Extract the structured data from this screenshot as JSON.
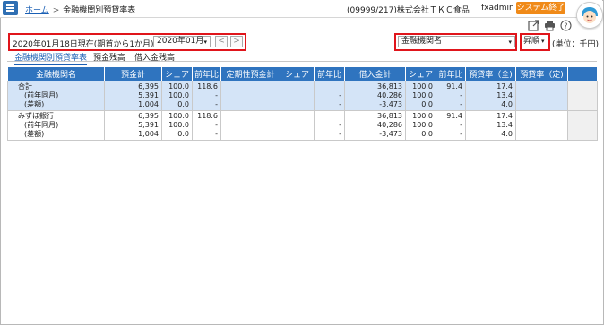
{
  "header": {
    "home_link": "ホーム",
    "breadcrumb_sep": ">",
    "page_title": "金融機関別預貸率表",
    "company": "(09999/217)株式会社ＴＫＣ食品",
    "user": "fxadmin",
    "user_caret": "▾",
    "system_exit": "システム終了"
  },
  "controls": {
    "date_label": "2020年01月18日現在(期首から1か月)",
    "month_value": "2020年01月",
    "prev_label": "<",
    "next_label": ">",
    "bank_select": "金融機関名",
    "order_select": "昇順",
    "caret": "▾",
    "unit": "(単位：千円)"
  },
  "tabs": [
    "金融機関別預貸率表",
    "預金残高",
    "借入金残高"
  ],
  "table": {
    "headers": [
      "金融機関名",
      "預金計",
      "シェア",
      "前年比",
      "定期性預金計",
      "シェア",
      "前年比",
      "借入金計",
      "シェア",
      "前年比",
      "預貸率（全)",
      "預貸率（定)"
    ],
    "rows": [
      {
        "name": [
          "合計",
          "(前年同月)",
          "(差額)"
        ],
        "deposit": [
          "6,395",
          "5,391",
          "1,004"
        ],
        "share": [
          "100.0",
          "100.0",
          "0.0"
        ],
        "yoy": [
          "118.6",
          "-",
          "-"
        ],
        "fixed_deposit": [
          "",
          "",
          ""
        ],
        "fixed_share": [
          "",
          "",
          ""
        ],
        "fixed_yoy": [
          "",
          "-",
          "-"
        ],
        "loan": [
          "36,813",
          "40,286",
          "-3,473"
        ],
        "loan_share": [
          "100.0",
          "100.0",
          "0.0"
        ],
        "loan_yoy": [
          "91.4",
          "-",
          "-"
        ],
        "ratio_all": [
          "17.4",
          "13.4",
          "4.0"
        ],
        "ratio_fixed": [
          "",
          "",
          ""
        ]
      },
      {
        "name": [
          "みずほ銀行",
          "(前年同月)",
          "(差額)"
        ],
        "deposit": [
          "6,395",
          "5,391",
          "1,004"
        ],
        "share": [
          "100.0",
          "100.0",
          "0.0"
        ],
        "yoy": [
          "118.6",
          "-",
          "-"
        ],
        "fixed_deposit": [
          "",
          "",
          ""
        ],
        "fixed_share": [
          "",
          "",
          ""
        ],
        "fixed_yoy": [
          "",
          "-",
          "-"
        ],
        "loan": [
          "36,813",
          "40,286",
          "-3,473"
        ],
        "loan_share": [
          "100.0",
          "100.0",
          "0.0"
        ],
        "loan_yoy": [
          "91.4",
          "-",
          "-"
        ],
        "ratio_all": [
          "17.4",
          "13.4",
          "4.0"
        ],
        "ratio_fixed": [
          "",
          "",
          ""
        ]
      }
    ]
  },
  "colors": {
    "accent": "#2f74bf",
    "highlight": "#e0151b",
    "exit_button": "#f08a18",
    "total_row": "#d4e4f7"
  },
  "icons": [
    "menu-icon",
    "export-icon",
    "print-icon",
    "help-icon",
    "avatar-icon"
  ]
}
